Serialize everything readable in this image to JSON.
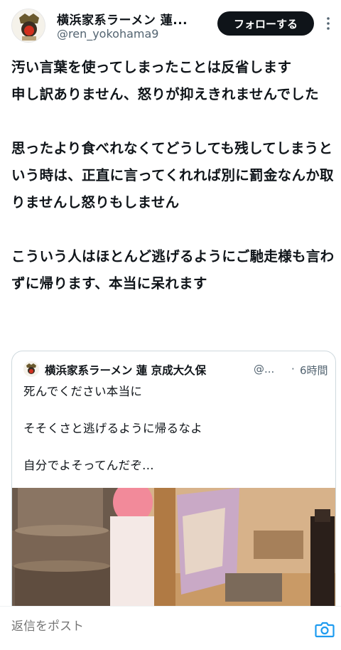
{
  "profile": {
    "display_name": "横浜家系ラーメン 蓮...",
    "handle": "@ren_yokohama9",
    "follow_label": "フォローする"
  },
  "tweet": {
    "text": "汚い言葉を使ってしまったことは反省します\n申し訳ありません、怒りが抑えきれませんでした\n\n思ったより食べれなくてどうしても残してしまうという時は、正直に言ってくれれば別に罰金なんか取りませんし怒りもしません\n\nこういう人はほとんど逃げるようにご馳走様も言わずに帰ります、本当に呆れます"
  },
  "quote": {
    "name": "横浜家系ラーメン 蓮 京成大久保",
    "handle": "@...",
    "separator": "·",
    "time": "6時間",
    "text": "死んでください本当に\n\nそそくさと逃げるように帰るなよ\n\n自分でよそってんだぞ..."
  },
  "reply_bar": {
    "placeholder": "返信をポスト"
  },
  "icons": {
    "more": "more-vertical-icon",
    "camera": "camera-icon"
  },
  "colors": {
    "follow_bg": "#0f1419",
    "secondary_text": "#536471",
    "accent": "#1d9bf0"
  }
}
